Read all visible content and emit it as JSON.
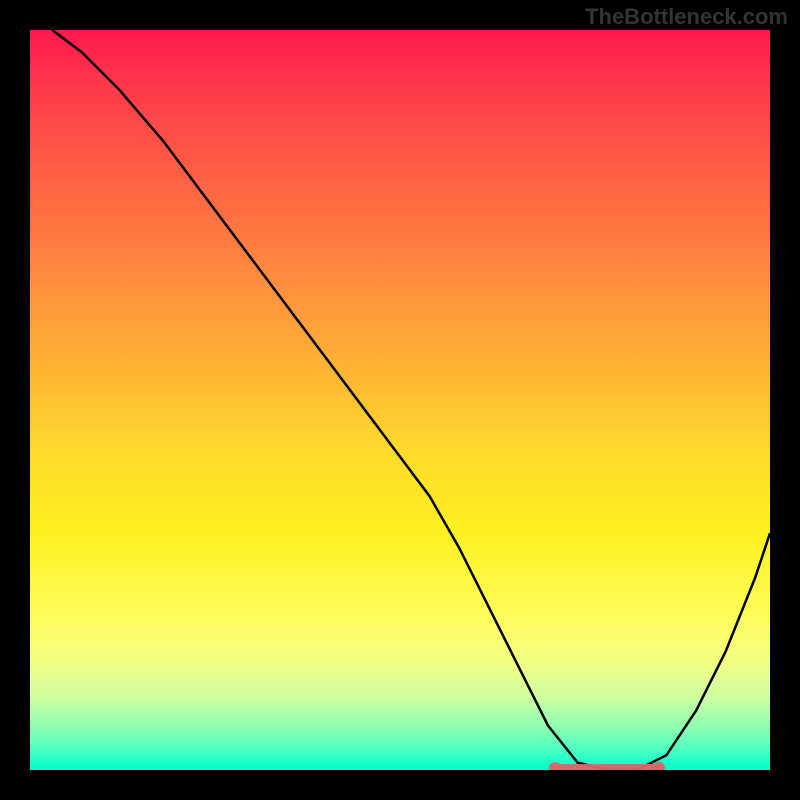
{
  "watermark": "TheBottleneck.com",
  "chart_data": {
    "type": "line",
    "title": "",
    "xlabel": "",
    "ylabel": "",
    "xlim": [
      0,
      100
    ],
    "ylim": [
      0,
      100
    ],
    "grid": false,
    "background": "rainbow-gradient-red-to-green-vertical",
    "series": [
      {
        "name": "bottleneck-curve",
        "x": [
          3,
          7,
          12,
          18,
          24,
          30,
          36,
          42,
          48,
          54,
          58,
          62,
          66,
          70,
          74,
          78,
          82,
          86,
          90,
          94,
          98,
          100
        ],
        "values": [
          100,
          97,
          92,
          85,
          77,
          69,
          61,
          53,
          45,
          37,
          30,
          22,
          14,
          6,
          1,
          0,
          0,
          2,
          8,
          16,
          26,
          32
        ]
      }
    ],
    "highlight_band": {
      "x_start": 71,
      "x_end": 85,
      "y": 0
    },
    "colors": {
      "curve": "#000000",
      "highlight": "#d46a6a",
      "gradient_top": "#ff1a4d",
      "gradient_bottom": "#00ffcc"
    }
  }
}
